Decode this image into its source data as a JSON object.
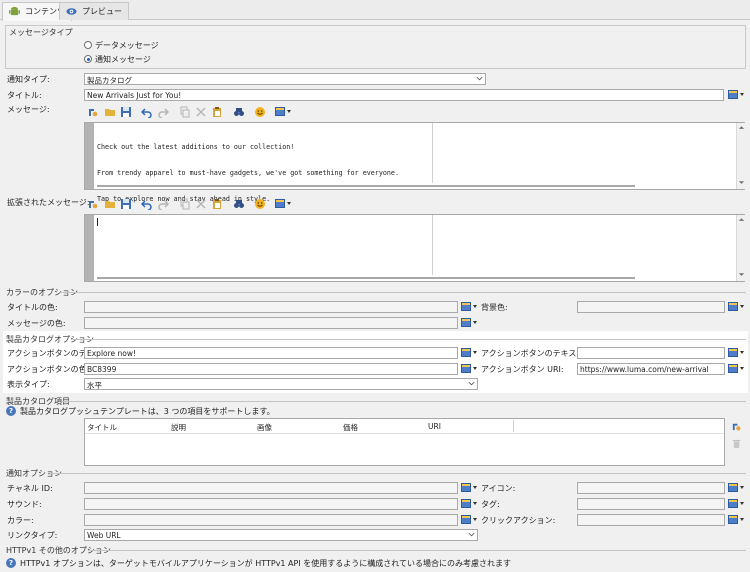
{
  "tabs": [
    {
      "label": "コンテンツ",
      "icon": "android-icon"
    },
    {
      "label": "プレビュー",
      "icon": "eye-icon"
    }
  ],
  "message_type": {
    "title": "メッセージタイプ",
    "options": [
      "データメッセージ",
      "通知メッセージ"
    ],
    "selected": "通知メッセージ"
  },
  "form": {
    "notification_type_label": "通知タイプ:",
    "notification_type_value": "製品カタログ",
    "title_label": "タイトル:",
    "title_value": "New Arrivals Just for You!",
    "message_label": "メッセージ:",
    "message_lines": [
      "Check out the latest additions to our collection!",
      "From trendy apparel to must-have gadgets, we've got something for everyone.",
      "Tap to explore now and stay ahead in style."
    ],
    "extended_message_label": "拡張されたメッセージ:"
  },
  "color_options": {
    "title": "カラーのオプション",
    "title_color_label": "タイトルの色:",
    "background_color_label": "背景色:",
    "message_color_label": "メッセージの色:"
  },
  "catalog_options": {
    "title": "製品カタログオプション",
    "action_button_text_label": "アクションボタンのテキスト:",
    "action_button_text_value": "Explore now!",
    "action_button_text_color_label": "アクションボタンのテキストの色:",
    "action_button_color_label": "アクションボタンの色:",
    "action_button_color_value": "BC8399",
    "action_button_uri_label": "アクションボタン URI:",
    "action_button_uri_value": "https://www.luma.com/new-arrival",
    "display_type_label": "表示タイプ:",
    "display_type_value": "水平"
  },
  "catalog_items": {
    "title": "製品カタログ項目",
    "info": "製品カタログプッシュテンプレートは、3 つの項目をサポートします。",
    "columns": [
      "タイトル",
      "説明",
      "画像",
      "価格",
      "URI"
    ]
  },
  "notification_options": {
    "title": "通知オプション",
    "channel_id_label": "チャネル ID:",
    "icon_label": "アイコン:",
    "sound_label": "サウンド:",
    "tag_label": "タグ:",
    "color_label": "カラー:",
    "click_action_label": "クリックアクション:",
    "link_type_label": "リンクタイプ:",
    "link_type_value": "Web URL"
  },
  "httpv1": {
    "title": "HTTPv1 その他のオプション",
    "info": "HTTPv1 オプションは、ターゲットモバイルアプリケーションが HTTPv1 API を使用するように構成されている場合にのみ考慮されます"
  },
  "colors": {
    "accent": "#1a62c4",
    "highlight": "#ffffff",
    "background": "#f0f0f0"
  }
}
